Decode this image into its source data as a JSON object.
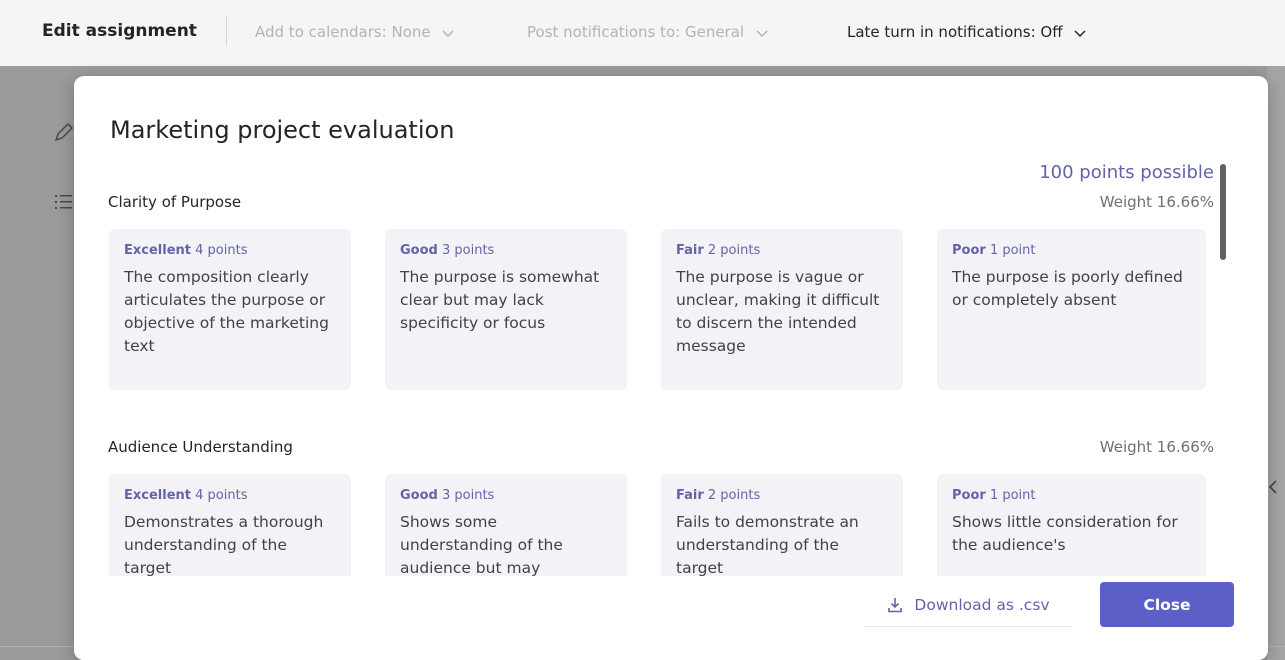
{
  "toolbar": {
    "title": "Edit assignment",
    "add_to_calendars": "Add to calendars: None",
    "post_notifications": "Post notifications to: General",
    "late_turn_in": "Late turn in notifications: Off"
  },
  "modal": {
    "title": "Marketing project evaluation",
    "points_possible": "100 points possible",
    "download_label": "Download as .csv",
    "close_label": "Close"
  },
  "criteria": [
    {
      "name": "Clarity of Purpose",
      "weight": "Weight 16.66%",
      "levels": [
        {
          "level": "Excellent",
          "points": "4 points",
          "description": "The composition clearly articulates the purpose or objective of the marketing text"
        },
        {
          "level": "Good",
          "points": "3 points",
          "description": "The purpose is somewhat clear but may lack specificity or focus"
        },
        {
          "level": "Fair",
          "points": "2 points",
          "description": "The purpose is vague or unclear, making it difficult to discern the intended message"
        },
        {
          "level": "Poor",
          "points": "1 point",
          "description": "The purpose is poorly defined or completely absent"
        }
      ]
    },
    {
      "name": "Audience Understanding",
      "weight": "Weight 16.66%",
      "levels": [
        {
          "level": "Excellent",
          "points": "4 points",
          "description": "Demonstrates a thorough understanding of the target"
        },
        {
          "level": "Good",
          "points": "3 points",
          "description": "Shows some understanding of the audience but may"
        },
        {
          "level": "Fair",
          "points": "2 points",
          "description": "Fails to demonstrate an understanding of the target"
        },
        {
          "level": "Poor",
          "points": "1 point",
          "description": "Shows little consideration for the audience's"
        }
      ]
    }
  ],
  "colors": {
    "accent": "#6264a7",
    "primary_button": "#5b5fc7",
    "card_bg": "#f3f3f7"
  }
}
